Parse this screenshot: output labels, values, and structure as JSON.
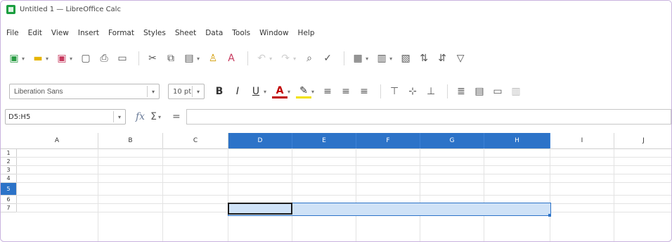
{
  "window": {
    "title": "Untitled 1 — LibreOffice Calc"
  },
  "menu": [
    "File",
    "Edit",
    "View",
    "Insert",
    "Format",
    "Styles",
    "Sheet",
    "Data",
    "Tools",
    "Window",
    "Help"
  ],
  "toolbar": {
    "font_name": "Liberation Sans",
    "font_size": "10 pt"
  },
  "formula_bar": {
    "name_box": "D5:H5",
    "formula": ""
  },
  "sheet": {
    "columns": [
      "A",
      "B",
      "C",
      "D",
      "E",
      "F",
      "G",
      "H",
      "I",
      "J"
    ],
    "rows": [
      "1",
      "2",
      "3",
      "4",
      "5",
      "6",
      "7"
    ],
    "selected_columns": [
      "D",
      "E",
      "F",
      "G",
      "H"
    ],
    "selected_row": "5",
    "accent_color": "#2c73c8"
  }
}
